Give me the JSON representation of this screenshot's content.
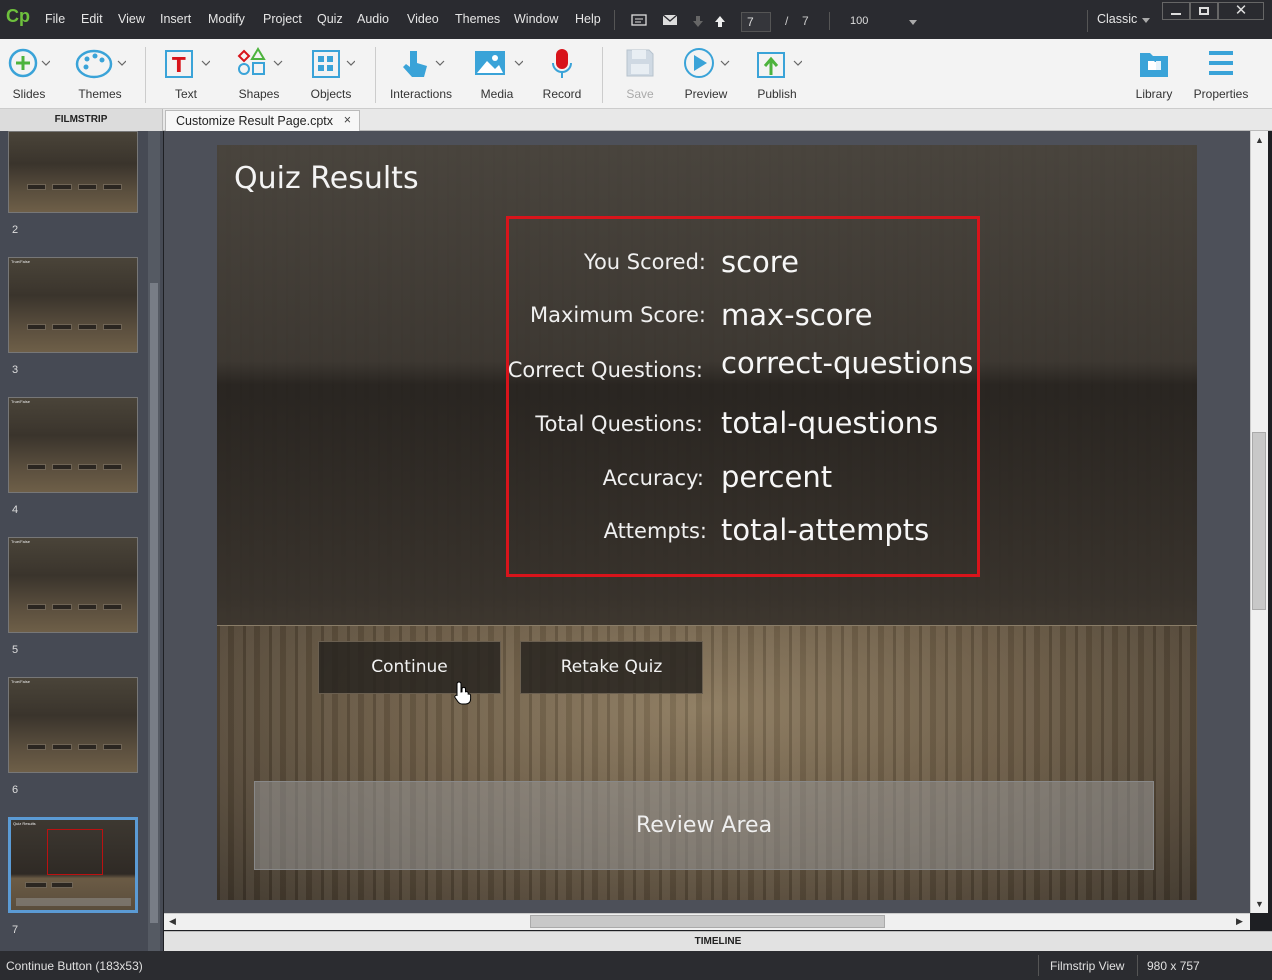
{
  "app": {
    "logo": "Cp",
    "workspace": "Classic"
  },
  "menu": [
    "File",
    "Edit",
    "View",
    "Insert",
    "Modify",
    "Project",
    "Quiz",
    "Audio",
    "Video",
    "Themes",
    "Window",
    "Help"
  ],
  "nav": {
    "current_page": "7",
    "total_pages": "7",
    "zoom": "100"
  },
  "toolbar": {
    "slides": "Slides",
    "themes": "Themes",
    "text": "Text",
    "shapes": "Shapes",
    "objects": "Objects",
    "interactions": "Interactions",
    "media": "Media",
    "record": "Record",
    "save": "Save",
    "preview": "Preview",
    "publish": "Publish",
    "library": "Library",
    "properties": "Properties"
  },
  "panels": {
    "filmstrip": "FILMSTRIP",
    "timeline": "TIMELINE"
  },
  "document_tab": {
    "name": "Customize Result Page.cptx",
    "close": "×"
  },
  "filmstrip": {
    "thumbnails": [
      {
        "number": "2",
        "title": ""
      },
      {
        "number": "3",
        "title": "True/False"
      },
      {
        "number": "4",
        "title": "True/False"
      },
      {
        "number": "5",
        "title": "True/False"
      },
      {
        "number": "6",
        "title": "True/False"
      },
      {
        "number": "7",
        "title": "Quiz Results"
      }
    ],
    "selected": "7"
  },
  "slide": {
    "title": "Quiz Results",
    "results": [
      {
        "label": "You Scored:",
        "value": "score"
      },
      {
        "label": "Maximum Score:",
        "value": "max-score"
      },
      {
        "label": "Correct Questions:",
        "value": "correct-questions"
      },
      {
        "label": "Total Questions:",
        "value": "total-questions"
      },
      {
        "label": "Accuracy:",
        "value": "percent"
      },
      {
        "label": "Attempts:",
        "value": "total-attempts"
      }
    ],
    "continue_button": "Continue",
    "retake_button": "Retake Quiz",
    "review_area": "Review Area"
  },
  "status": {
    "selection": "Continue Button (183x53)",
    "view": "Filmstrip View",
    "size": "980 x 757"
  },
  "colors": {
    "accent": "#6ec13d",
    "highlight": "#d8141b",
    "selection": "#5b9bd5"
  }
}
